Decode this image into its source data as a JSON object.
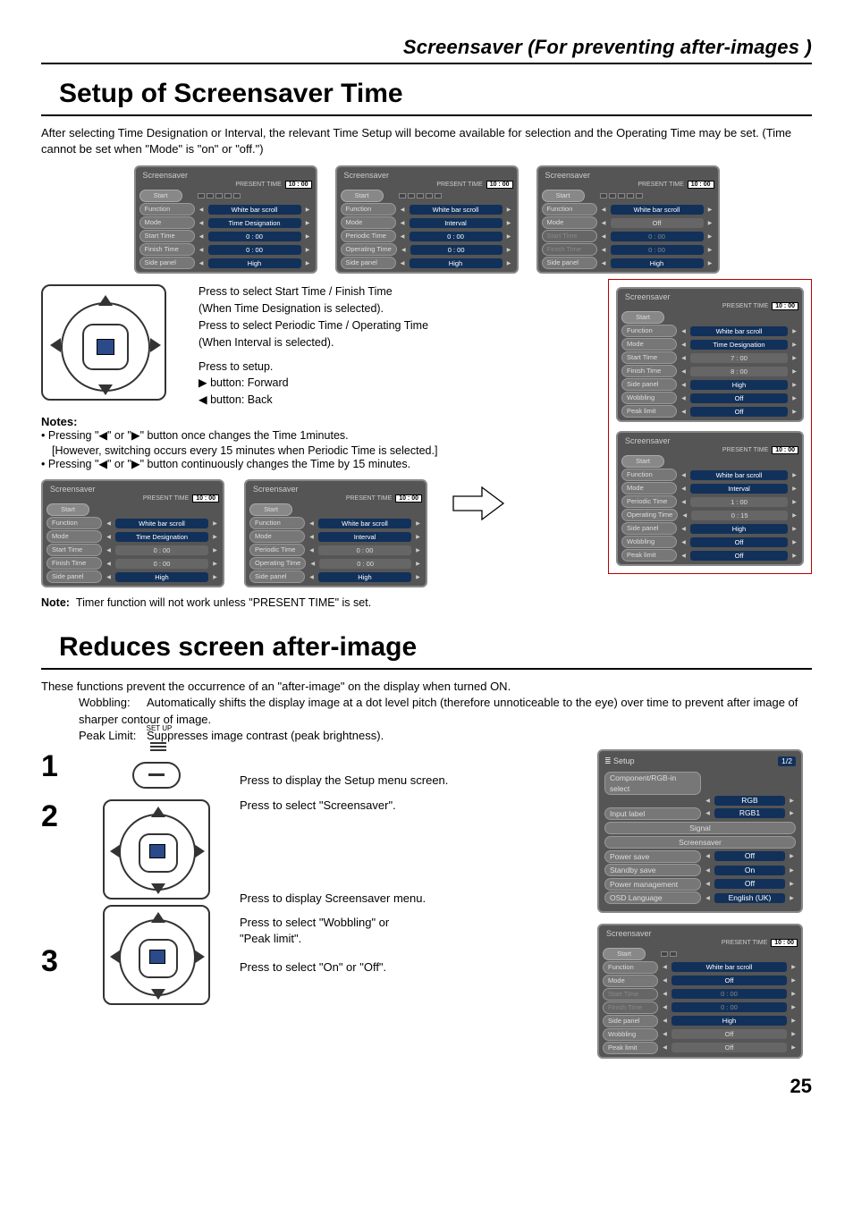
{
  "header": {
    "title": "Screensaver (For preventing after-images )"
  },
  "section1": {
    "heading": "Setup of Screensaver Time",
    "intro": "After selecting Time Designation or Interval, the relevant Time Setup will become available for selection and the Operating Time may be set. (Time cannot be set when \"Mode\" is \"on\" or \"off.\")",
    "present_label": "PRESENT  TIME",
    "present_value": "10 : 00",
    "osd_title": "Screensaver",
    "labels": {
      "start": "Start",
      "function": "Function",
      "mode": "Mode",
      "start_time": "Start Time",
      "finish_time": "Finish Time",
      "periodic_time": "Periodic Time",
      "operating_time": "Operating Time",
      "side_panel": "Side  panel",
      "wobbling": "Wobbling",
      "peak_limit": "Peak limit"
    },
    "values": {
      "white_bar": "White bar scroll",
      "time_desig": "Time Designation",
      "interval": "Interval",
      "off": "Off",
      "high": "High",
      "z": "0 : 00",
      "t7": "7 : 00",
      "t8": "8 : 00",
      "t1": "1 : 00",
      "t015": "0 : 15"
    },
    "instr": {
      "l1": "Press to select Start Time / Finish Time",
      "l2": "(When Time Designation is selected).",
      "l3": "Press to select Periodic Time / Operating Time",
      "l4": "(When Interval  is selected).",
      "l5": "Press to setup.",
      "l6": "▶ button: Forward",
      "l7": "◀ button: Back"
    },
    "notes_h": "Notes:",
    "note1a": "Pressing \"◀\" or \"▶\" button once changes the Time 1minutes.",
    "note1b": "[However, switching occurs every 15 minutes when Periodic Time is selected.]",
    "note2": "Pressing \"◀\" or \"▶\" button continuously changes the Time by 15 minutes.",
    "foot": "Timer function will not work unless \"PRESENT TIME\" is set.",
    "foot_label": "Note:"
  },
  "section2": {
    "heading": "Reduces screen after-image",
    "para": "These functions prevent the occurrence of an \"after-image\" on the display when turned ON.",
    "wob_t": "Wobbling:",
    "wob_d": "Automatically shifts the display image at a dot level pitch (therefore unnoticeable to the eye) over time to prevent after image of sharper contour of image.",
    "pl_t": "Peak Limit:",
    "pl_d": "Suppresses image contrast (peak brightness).",
    "setup_label": "SET UP",
    "s1": "Press to display the Setup menu screen.",
    "s2": "Press to select \"Screensaver\".",
    "s3": "Press to display Screensaver menu.",
    "s4a": "Press to select \"Wobbling\" or",
    "s4b": "\"Peak limit\".",
    "s5": "Press to select \"On\" or \"Off\".",
    "n1": "1",
    "n2": "2",
    "n3": "3",
    "setup_menu": {
      "title": "Setup",
      "page": "1/2",
      "comp": "Component/RGB-in  select",
      "rgb": "RGB",
      "input_label": "Input label",
      "rgb1": "RGB1",
      "signal": "Signal",
      "screensaver": "Screensaver",
      "power_save": "Power save",
      "standby_save": "Standby save",
      "pm": "Power management",
      "osd_lang": "OSD  Language",
      "off": "Off",
      "on": "On",
      "eng": "English (UK)"
    }
  },
  "page_number": "25"
}
